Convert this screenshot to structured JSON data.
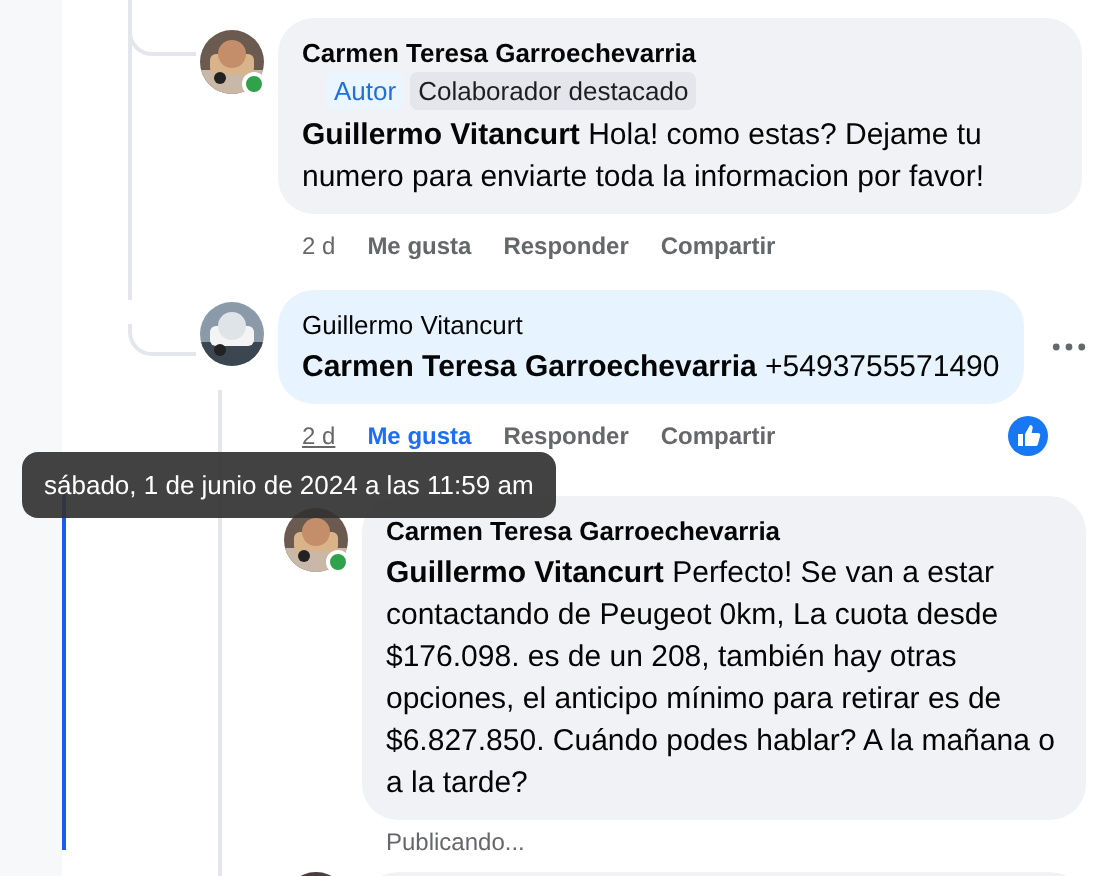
{
  "comments": [
    {
      "kind": "comment",
      "author": "Carmen Teresa Garroechevarria",
      "online": true,
      "badges": [
        {
          "label": "Autor",
          "kind": "role"
        },
        {
          "label": "Colaborador destacado",
          "kind": "award"
        }
      ],
      "mention": "Guillermo Vitancurt",
      "text": "Hola! como estas? Dejame tu numero para enviarte toda la informacion por favor!",
      "highlighted": false,
      "time": "2 d",
      "time_hovered": false,
      "actions": [
        {
          "label": "Me gusta",
          "selected": false
        },
        {
          "label": "Responder",
          "selected": false
        },
        {
          "label": "Compartir",
          "selected": false
        }
      ],
      "reaction": false,
      "menu": false
    },
    {
      "kind": "comment",
      "author": "Guillermo Vitancurt",
      "online": false,
      "mention": "Carmen Teresa Garroechevarria",
      "text": "+5493755571490",
      "highlighted": true,
      "time": "2 d",
      "time_hovered": true,
      "actions": [
        {
          "label": "Me gusta",
          "selected": true
        },
        {
          "label": "Responder",
          "selected": false
        },
        {
          "label": "Compartir",
          "selected": false
        }
      ],
      "reaction": true,
      "menu": true,
      "children": [
        {
          "kind": "comment",
          "author": "Carmen Teresa Garroechevarria",
          "online": true,
          "mention": "Guillermo Vitancurt",
          "text": "Perfecto! Se van a estar contactando de Peugeot 0km, La cuota desde $176.098. es de un 208, también hay otras opciones, el anticipo mínimo para retirar es de $6.827.850. Cuándo podes hablar? A la mañana o a la tarde?",
          "highlighted": false,
          "status": "Publicando..."
        },
        {
          "kind": "cut_off"
        }
      ]
    }
  ],
  "tooltip": {
    "text": "sábado, 1 de junio de 2024 a las 11:59 am"
  }
}
